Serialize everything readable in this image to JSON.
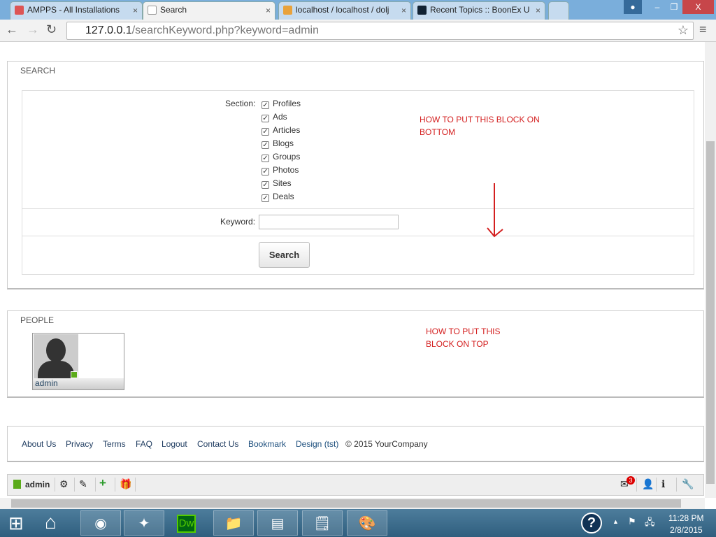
{
  "browser": {
    "tabs": [
      {
        "label": "AMPPS - All Installations",
        "active": false
      },
      {
        "label": "Search",
        "active": true
      },
      {
        "label": "localhost / localhost / dolj",
        "active": false
      },
      {
        "label": "Recent Topics :: BoonEx U",
        "active": false
      }
    ],
    "url_host": "127.0.0.1",
    "url_path": "/searchKeyword.php?keyword=admin"
  },
  "search": {
    "title": "SEARCH",
    "section_label": "Section:",
    "sections": [
      "Profiles",
      "Ads",
      "Articles",
      "Blogs",
      "Groups",
      "Photos",
      "Sites",
      "Deals"
    ],
    "keyword_label": "Keyword:",
    "keyword_value": "",
    "button": "Search",
    "annotation": "HOW TO PUT THIS BLOCK ON BOTTOM"
  },
  "people": {
    "title": "PEOPLE",
    "users": [
      {
        "name": "admin",
        "online": true
      }
    ],
    "annotation": "HOW TO PUT THIS BLOCK ON TOP"
  },
  "footer": {
    "links": [
      "About Us",
      "Privacy",
      "Terms",
      "FAQ",
      "Logout",
      "Contact Us",
      "Bookmark",
      "Design (tst)"
    ],
    "copyright": "© 2015 YourCompany"
  },
  "toolbar": {
    "user": "admin",
    "mail_count": "3"
  },
  "taskbar": {
    "time": "11:28 PM",
    "date": "2/8/2015"
  },
  "colors": {
    "annotation": "#d42020",
    "online": "#5bab1a",
    "link": "#1d4f7d"
  }
}
